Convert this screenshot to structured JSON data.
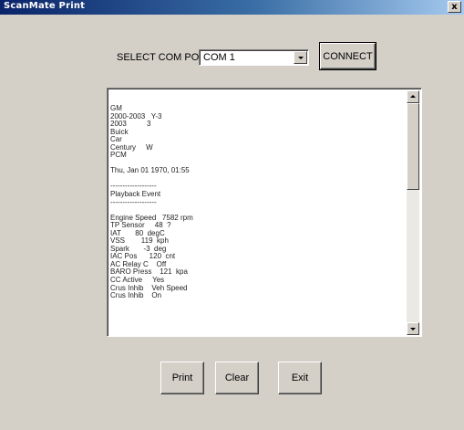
{
  "window": {
    "title": "ScanMate Print",
    "close_glyph": "x",
    "colors": {
      "face": "#d4d0c8",
      "title_start": "#0a246a",
      "title_end": "#a6caf0"
    }
  },
  "com_port": {
    "label": "SELECT COM PORT",
    "selected": "COM 1",
    "connect_label": "CONNECT"
  },
  "log": {
    "lines": [
      "GM",
      "2000-2003   Y-3",
      "2003          3",
      "Buick",
      "Car",
      "Century     W",
      "PCM",
      "",
      "Thu, Jan 01 1970, 01:55",
      "",
      "-------------------",
      "Playback Event",
      "-------------------",
      "",
      "Engine Speed   7582 rpm",
      "TP Sensor     48  ?",
      "IAT       80  degC",
      "VSS        119  kph",
      "Spark       -3  deg",
      "IAC Pos      120  cnt",
      "AC Relay C    Off",
      "BARO Press    121  kpa",
      "CC Active     Yes",
      "Crus Inhib    Veh Speed",
      "Crus Inhib    On"
    ]
  },
  "buttons": {
    "print": "Print",
    "clear": "Clear",
    "exit": "Exit"
  },
  "icons": {
    "close": "close-icon",
    "dropdown": "chevron-down-icon",
    "scroll_up": "arrow-up-icon",
    "scroll_down": "arrow-down-icon"
  }
}
